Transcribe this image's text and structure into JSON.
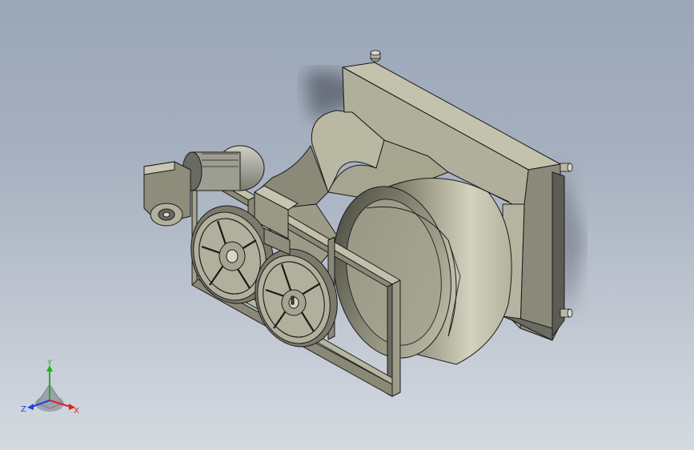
{
  "view": {
    "type": "3D CAD model viewport",
    "background_gradient": [
      "#9ba7b8",
      "#d5dae1"
    ],
    "model_colors": {
      "light": "#c9c8b4",
      "mid": "#a9a893",
      "dark": "#77766a",
      "shadow": "#4e4e45",
      "edge": "#1a1a1a"
    }
  },
  "triad": {
    "x_label": "X",
    "y_label": "Y",
    "z_label": "Z",
    "x_color": "#e02020",
    "y_color": "#20b020",
    "z_color": "#2040e0"
  }
}
